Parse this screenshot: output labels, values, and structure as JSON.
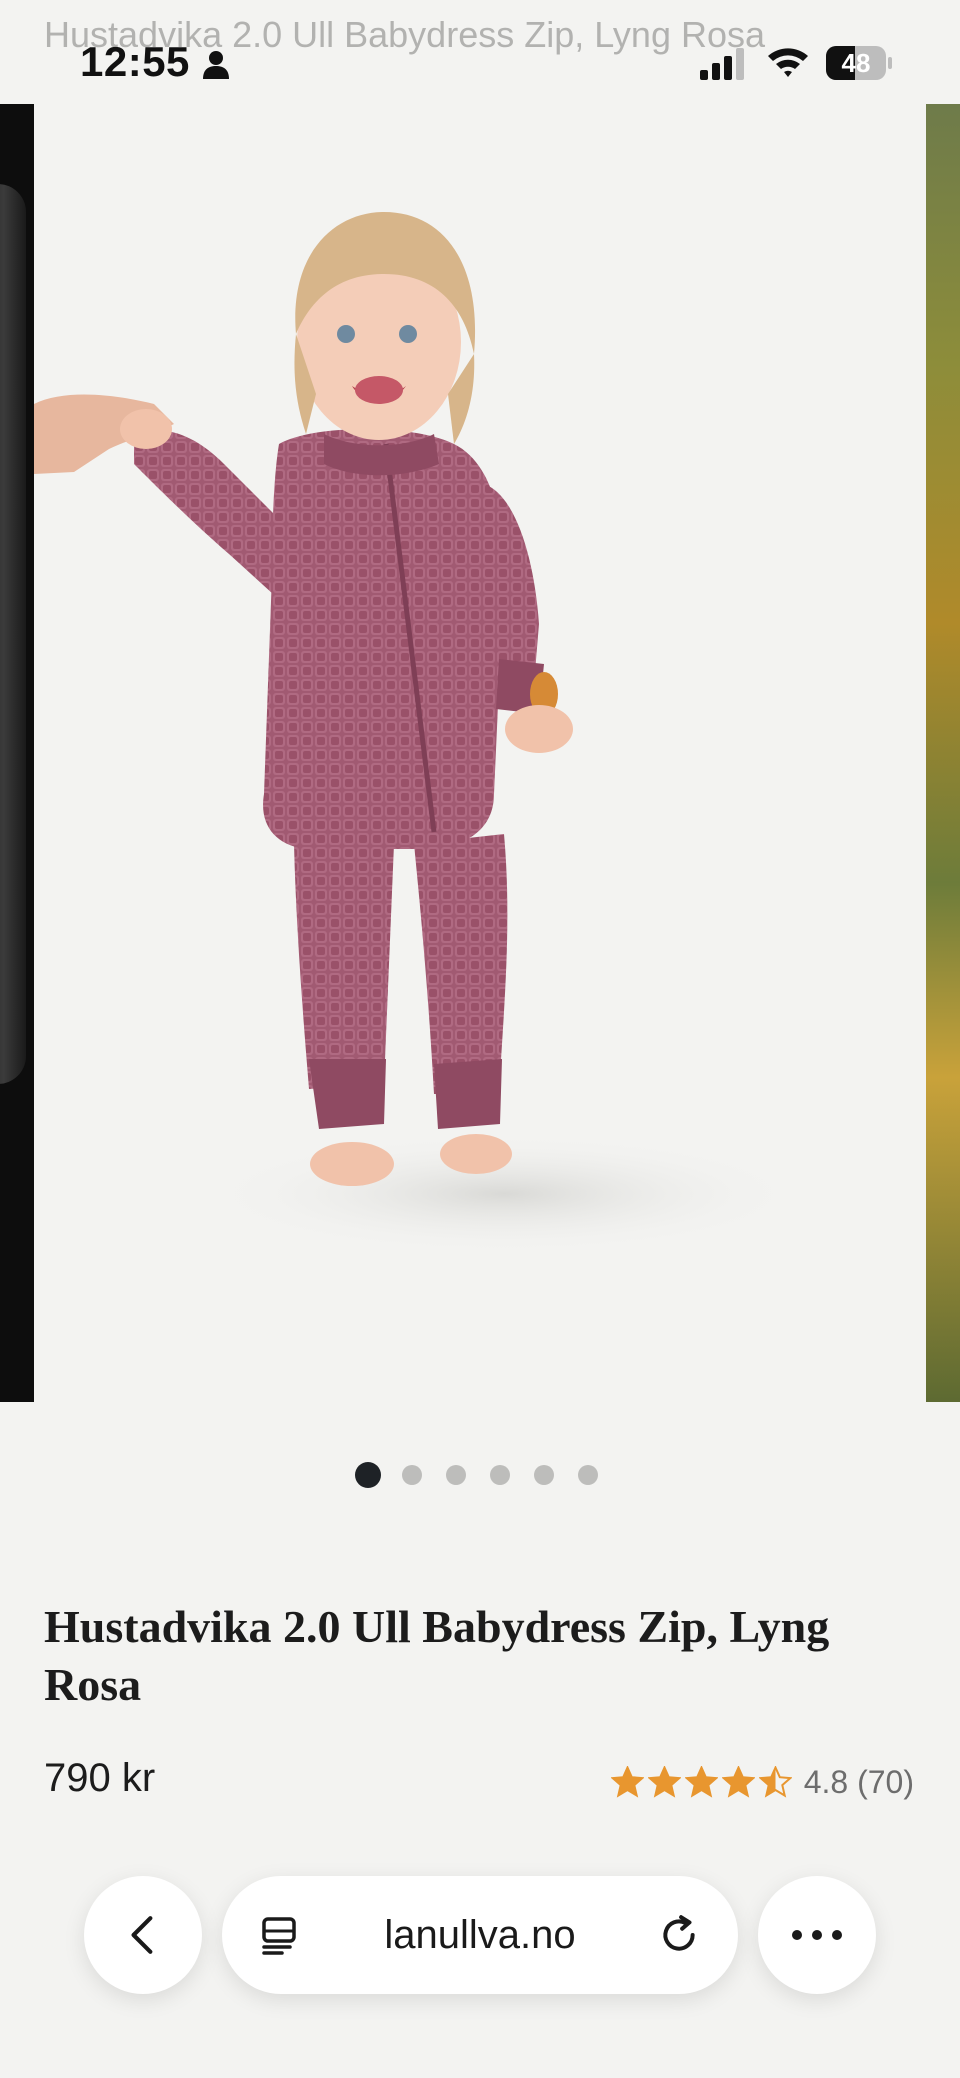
{
  "status_bar": {
    "time": "12:55",
    "battery_level": "48",
    "icons": [
      "person-icon",
      "cellular-signal-icon",
      "wifi-icon",
      "battery-icon"
    ]
  },
  "header": {
    "ghost_title": "Hustadvika 2.0 Ull Babydress Zip, Lyng Rosa"
  },
  "carousel": {
    "slide_count": 6,
    "active_index": 0,
    "photo_colors": {
      "garment": "#a15a72",
      "background": "#f3f3f1"
    }
  },
  "product": {
    "title": "Hustadvika 2.0 Ull Babydress Zip, Lyng Rosa",
    "price": "790 kr",
    "rating_value": 4.8,
    "rating_text": "4.8 (70)",
    "star_color": "#e8962f"
  },
  "browser_toolbar": {
    "back_icon": "chevron-left-icon",
    "reader_icon": "reader-mode-icon",
    "url": "lanullva.no",
    "reload_icon": "reload-icon",
    "more_icon": "more-dots-icon"
  }
}
